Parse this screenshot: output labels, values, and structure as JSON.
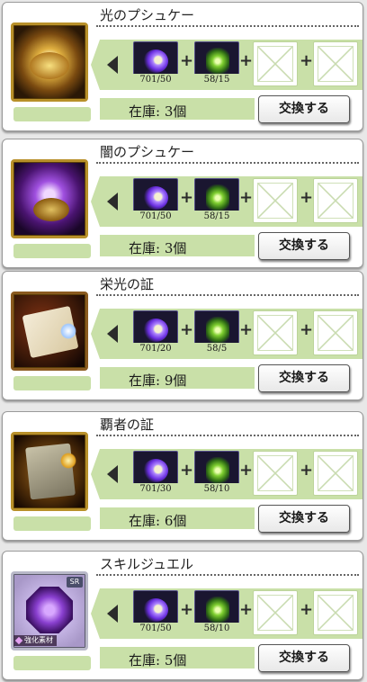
{
  "items": [
    {
      "name": "光のプシュケー",
      "thumb_style": "light",
      "materials": [
        {
          "count": "701/50"
        },
        {
          "count": "58/15"
        }
      ],
      "stock": "在庫: 3個",
      "exchange_label": "交換する"
    },
    {
      "name": "闇のプシュケー",
      "thumb_style": "dark",
      "materials": [
        {
          "count": "701/50"
        },
        {
          "count": "58/15"
        }
      ],
      "stock": "在庫: 3個",
      "exchange_label": "交換する"
    },
    {
      "name": "栄光の証",
      "thumb_style": "scroll",
      "materials": [
        {
          "count": "701/20"
        },
        {
          "count": "58/5"
        }
      ],
      "stock": "在庫: 9個",
      "exchange_label": "交換する"
    },
    {
      "name": "覇者の証",
      "thumb_style": "scroll-gold",
      "materials": [
        {
          "count": "701/30"
        },
        {
          "count": "58/10"
        }
      ],
      "stock": "在庫: 6個",
      "exchange_label": "交換する"
    },
    {
      "name": "スキルジュエル",
      "thumb_style": "jewel",
      "rarity_badge": "SR",
      "tag_label": "強化素材",
      "materials": [
        {
          "count": "701/50"
        },
        {
          "count": "58/10"
        }
      ],
      "stock": "在庫: 5個",
      "exchange_label": "交換する"
    }
  ],
  "icons": {
    "material_1": "purple-crystal-icon",
    "material_2": "green-crystal-icon",
    "empty_slot": "empty-slot-icon",
    "left_arrow": "left-arrow-icon",
    "plus": "plus-icon"
  },
  "colors": {
    "band": "#c9e0a8",
    "card_bg": "#ffffff",
    "gold_frame": "#b8902a"
  }
}
